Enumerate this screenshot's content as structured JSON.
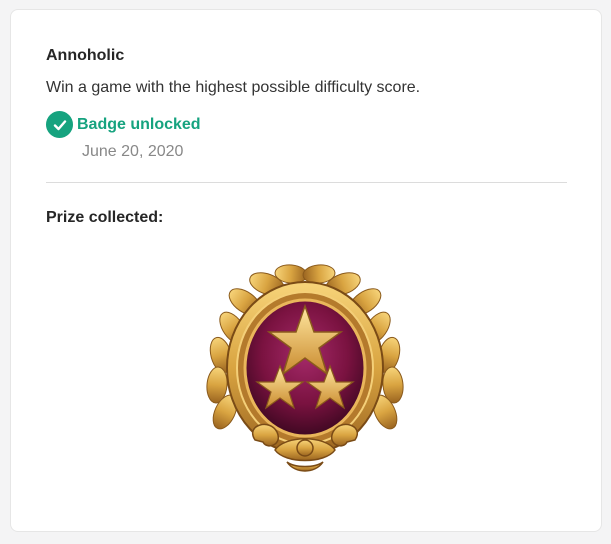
{
  "achievement": {
    "title": "Annoholic",
    "description": "Win a game with the highest possible difficulty score.",
    "status_label": "Badge unlocked",
    "unlock_date": "June 20, 2020",
    "prize_label": "Prize collected:",
    "badge_icon": "three-star-laurel-medal",
    "check_icon": "checkmark-circle-icon"
  },
  "colors": {
    "accent_green": "#16a37f",
    "badge_purple": "#7a1240",
    "badge_gold": "#d9a441"
  }
}
